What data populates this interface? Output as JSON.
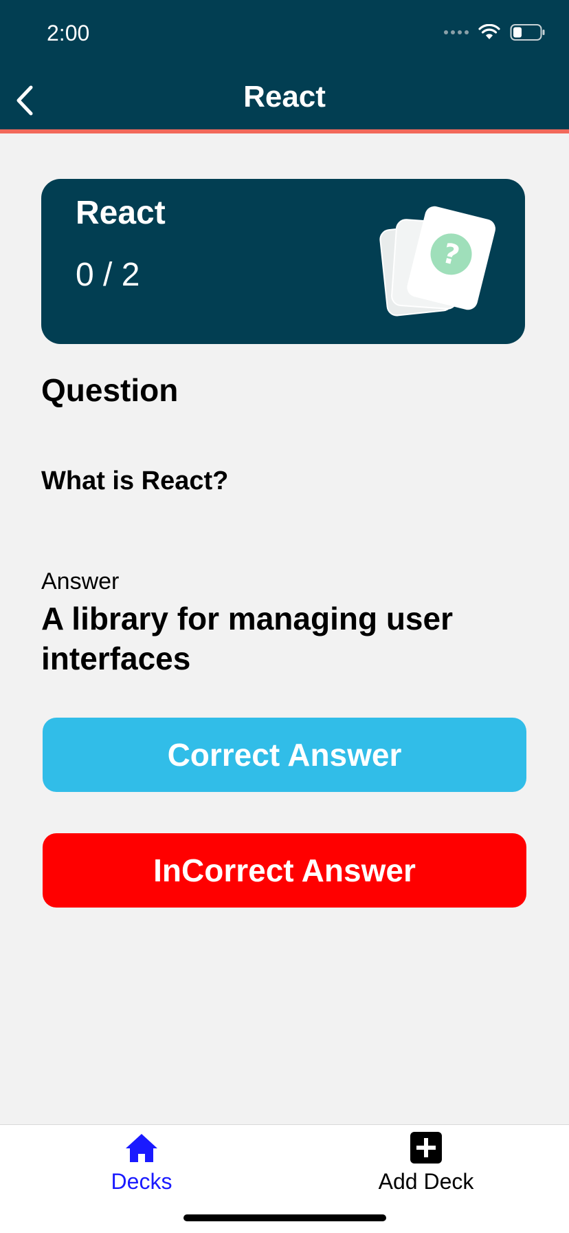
{
  "status_bar": {
    "time": "2:00"
  },
  "nav": {
    "title": "React",
    "back_icon": "chevron-left-icon"
  },
  "deck": {
    "title": "React",
    "progress": "0 / 2",
    "illustration_icon": "question-cards-icon"
  },
  "question": {
    "heading": "Question",
    "text": "What is React?"
  },
  "answer": {
    "label": "Answer",
    "text": "A library for managing user interfaces"
  },
  "buttons": {
    "correct_label": "Correct Answer",
    "incorrect_label": "InCorrect Answer"
  },
  "tabs": [
    {
      "label": "Decks",
      "icon": "home-icon",
      "active": true
    },
    {
      "label": "Add Deck",
      "icon": "add-square-icon",
      "active": false
    }
  ],
  "colors": {
    "header_bg": "#023e52",
    "header_accent": "#f2695b",
    "correct": "#31bde8",
    "incorrect": "#ff0000",
    "active_tab": "#1a1aff"
  }
}
